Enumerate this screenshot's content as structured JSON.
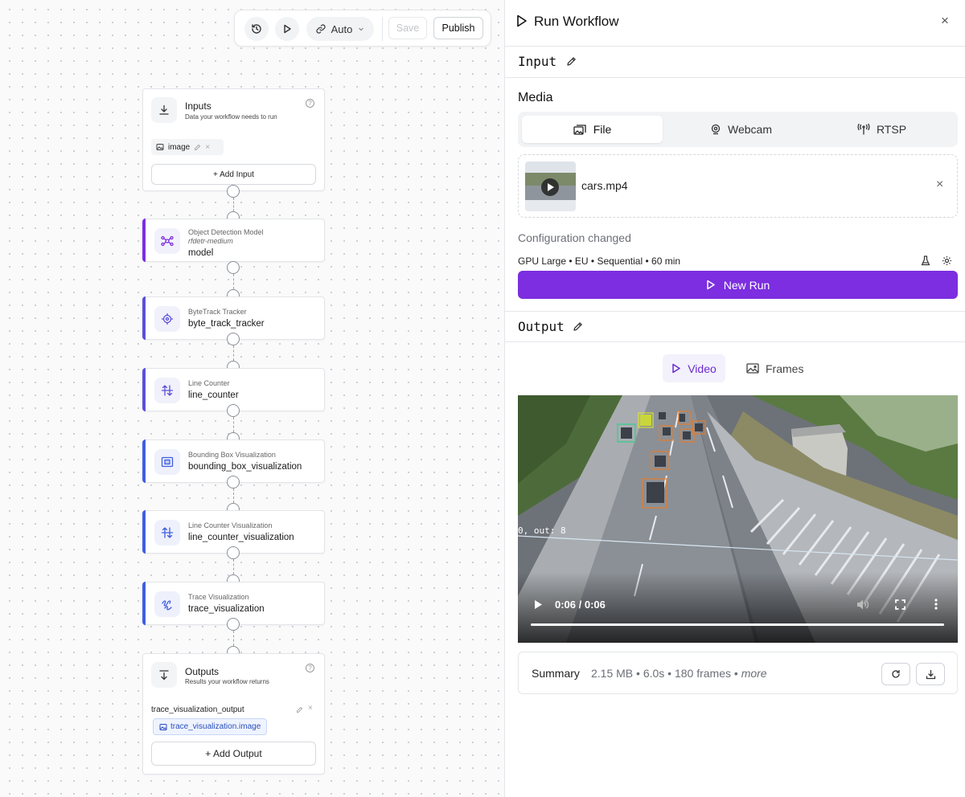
{
  "toolbar": {
    "mode_label": "Auto",
    "save_label": "Save",
    "publish_label": "Publish"
  },
  "inputs_node": {
    "title": "Inputs",
    "description": "Data your workflow needs to run",
    "input_chip_label": "image",
    "add_label": "+ Add Input"
  },
  "steps": [
    {
      "type": "Object Detection Model",
      "subtitle": "rfdetr-medium",
      "name": "model",
      "accent": "#7c2ee0"
    },
    {
      "type": "ByteTrack Tracker",
      "name": "byte_track_tracker",
      "accent": "#5b4fd9"
    },
    {
      "type": "Line Counter",
      "name": "line_counter",
      "accent": "#5b4fd9"
    },
    {
      "type": "Bounding Box Visualization",
      "name": "bounding_box_visualization",
      "accent": "#3f5ee0"
    },
    {
      "type": "Line Counter Visualization",
      "name": "line_counter_visualization",
      "accent": "#3f5ee0"
    },
    {
      "type": "Trace Visualization",
      "name": "trace_visualization",
      "accent": "#3f5ee0"
    }
  ],
  "outputs_node": {
    "title": "Outputs",
    "description": "Results your workflow returns",
    "output_name": "trace_visualization_output",
    "output_value": "trace_visualization.image",
    "add_label": "+ Add Output"
  },
  "panel": {
    "title": "Run Workflow",
    "close_glyph": "×",
    "input_heading": "Input",
    "media_label": "Media",
    "media_tabs": [
      "File",
      "Webcam",
      "RTSP"
    ],
    "file_name": "cars.mp4",
    "config_status": "Configuration changed",
    "config_summary": "GPU Large • EU • Sequential • 60 min",
    "new_run_label": "New Run",
    "output_heading": "Output",
    "output_tabs": [
      "Video",
      "Frames"
    ],
    "video_overlay_text": "0, out: 8",
    "video_time": "0:06 / 0:06",
    "video_progress": 1.0,
    "summary_label": "Summary",
    "summary_stats": "2.15 MB • 6.0s • 180 frames •",
    "summary_more": "more"
  },
  "colors": {
    "primary": "#7c2ee0",
    "border": "#e4e6ea"
  }
}
